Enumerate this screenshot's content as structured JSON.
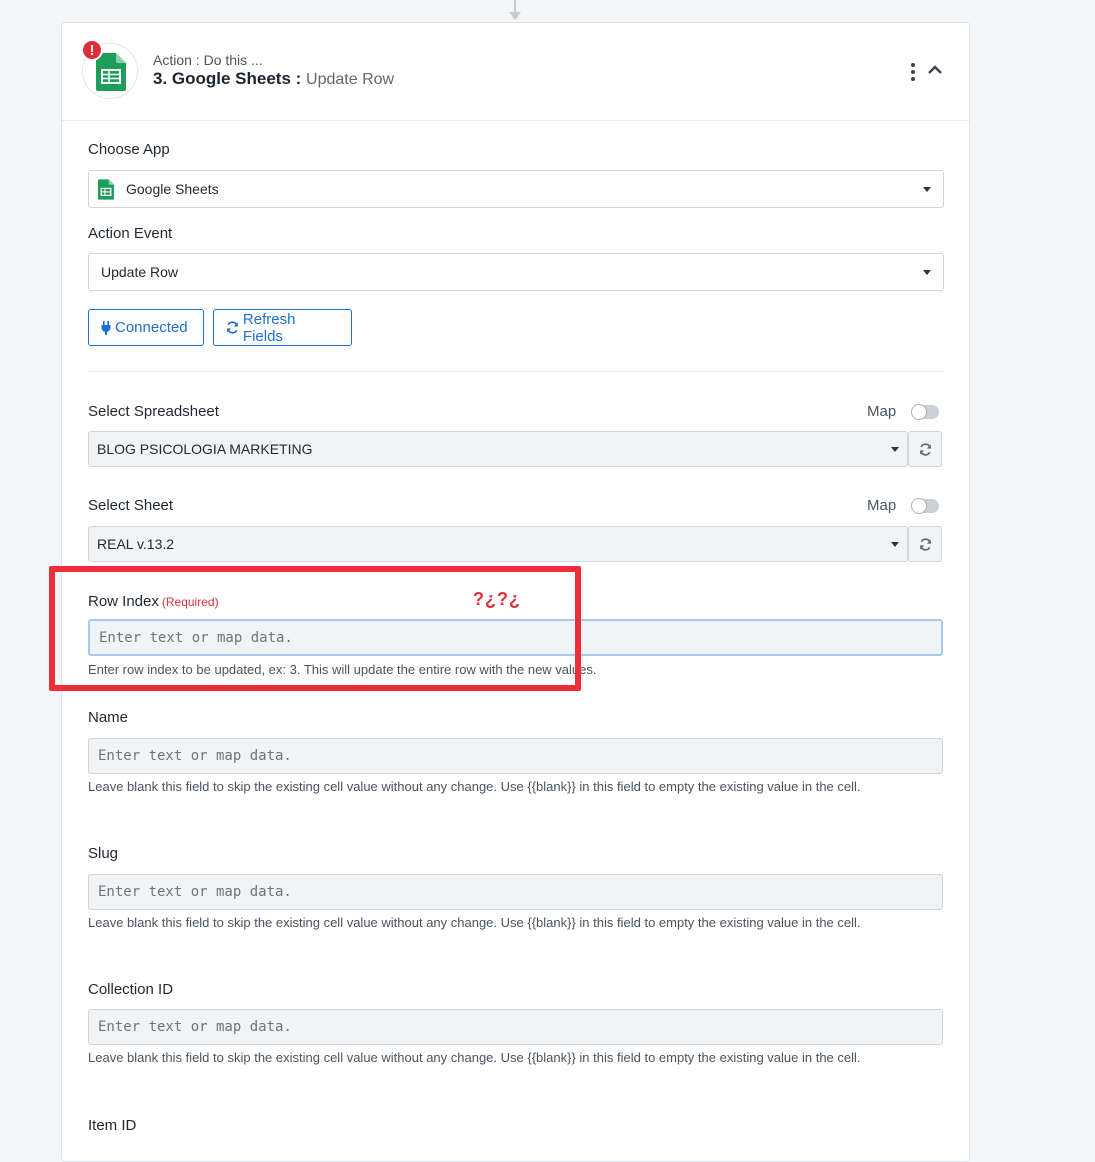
{
  "header": {
    "subtitle": "Action : Do this ...",
    "title": "3. Google Sheets :",
    "event": "Update Row",
    "alert": "!"
  },
  "choose_app": {
    "label": "Choose App",
    "value": "Google Sheets"
  },
  "action_event": {
    "label": "Action Event",
    "value": "Update Row"
  },
  "buttons": {
    "connected": "Connected",
    "refresh_fields": "Refresh Fields"
  },
  "spreadsheet": {
    "label": "Select Spreadsheet",
    "map_label": "Map",
    "value": "BLOG PSICOLOGIA MARKETING"
  },
  "sheet": {
    "label": "Select Sheet",
    "map_label": "Map",
    "value": "REAL v.13.2"
  },
  "row_index": {
    "label": "Row Index",
    "required": "(Required)",
    "placeholder": "Enter text or map data.",
    "help": "Enter row index to be updated, ex: 3. This will update the entire row with the new values."
  },
  "fields": [
    {
      "label": "Name",
      "placeholder": "Enter text or map data.",
      "help": "Leave blank this field to skip the existing cell value without any change. Use {{blank}} in this field to empty the existing value in the cell."
    },
    {
      "label": "Slug",
      "placeholder": "Enter text or map data.",
      "help": "Leave blank this field to skip the existing cell value without any change. Use {{blank}} in this field to empty the existing value in the cell."
    },
    {
      "label": "Collection ID",
      "placeholder": "Enter text or map data.",
      "help": "Leave blank this field to skip the existing cell value without any change. Use {{blank}} in this field to empty the existing value in the cell."
    },
    {
      "label": "Item ID"
    }
  ],
  "annotation": {
    "text": "?¿?¿",
    "color": "#ee2d3b"
  },
  "colors": {
    "accent": "#1f6fd0",
    "sheets_green": "#1e9e5a",
    "alert_red": "#e02b3a"
  }
}
